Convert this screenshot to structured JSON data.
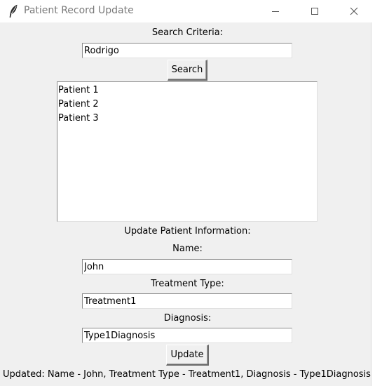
{
  "window": {
    "title": "Patient Record Update",
    "app_icon": "feather-icon",
    "controls": [
      "minimize-icon",
      "maximize-icon",
      "close-icon"
    ]
  },
  "search": {
    "label": "Search Criteria:",
    "value": "Rodrigo",
    "button_label": "Search"
  },
  "results": {
    "items": [
      "Patient 1",
      "Patient 2",
      "Patient 3"
    ]
  },
  "update": {
    "section_label": "Update Patient Information:",
    "name_label": "Name:",
    "name_value": "John",
    "treatment_label": "Treatment Type:",
    "treatment_value": "Treatment1",
    "diagnosis_label": "Diagnosis:",
    "diagnosis_value": "Type1Diagnosis",
    "button_label": "Update"
  },
  "status": {
    "text": "Updated: Name - John, Treatment Type - Treatment1, Diagnosis - Type1Diagnosis"
  }
}
